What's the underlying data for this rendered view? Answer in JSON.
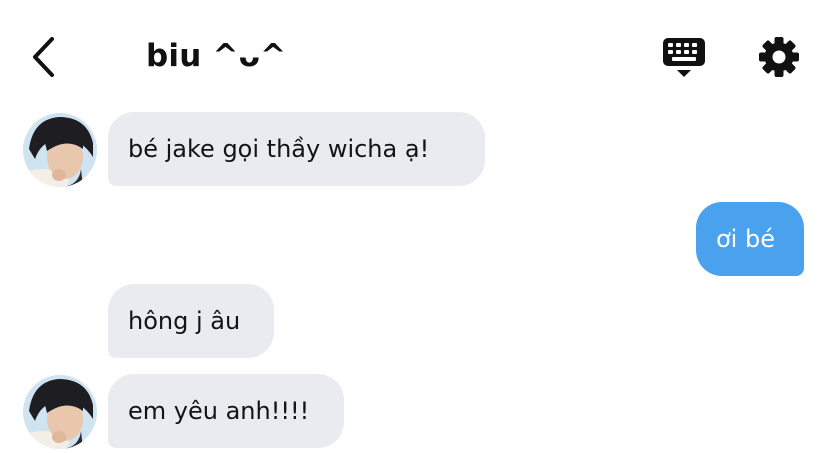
{
  "header": {
    "title": "biu ^ᴗ^",
    "back_icon": "chevron-left-icon",
    "keyboard_icon": "keyboard-icon",
    "settings_icon": "gear-icon"
  },
  "messages": [
    {
      "side": "incoming",
      "text": "bé jake gọi thầy wicha ạ!",
      "avatar": true
    },
    {
      "side": "outgoing",
      "text": "ơi bé"
    },
    {
      "side": "incoming",
      "text": "hông j âu",
      "avatar": false
    },
    {
      "side": "incoming",
      "text": "em yêu anh!!!!",
      "avatar": true
    }
  ],
  "colors": {
    "incoming_bubble": "#E9EBF0",
    "outgoing_bubble": "#4AA1EE",
    "outgoing_text": "#FFFFFF"
  }
}
